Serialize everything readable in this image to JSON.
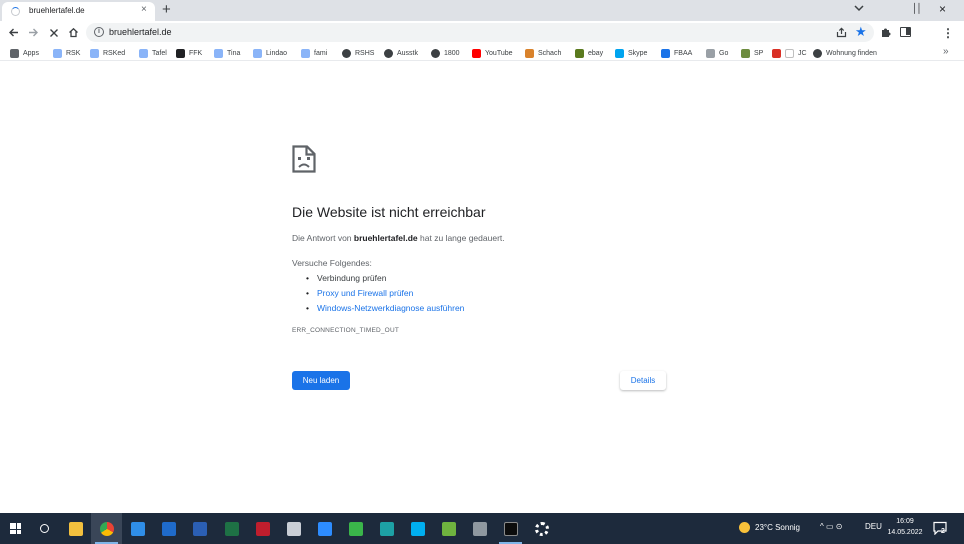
{
  "tab": {
    "title": "bruehlertafel.de",
    "close": "×"
  },
  "tabstrip": {
    "new_tab": "+",
    "minimize": "││",
    "close": "×"
  },
  "toolbar": {
    "url": "bruehlertafel.de",
    "star": "★",
    "menu": "⋮"
  },
  "bookmarks": {
    "items": [
      {
        "label": "Apps",
        "icon": "apps-icon",
        "color": "#5f6368"
      },
      {
        "label": "RSK",
        "icon": "doc-icon",
        "color": "#8ab4f8"
      },
      {
        "label": "RSKed",
        "icon": "doc-icon",
        "color": "#8ab4f8"
      },
      {
        "label": "Tafel",
        "icon": "doc-icon",
        "color": "#8ab4f8"
      },
      {
        "label": "FFK",
        "icon": "site-icon",
        "color": "#202124"
      },
      {
        "label": "Tina",
        "icon": "doc-icon",
        "color": "#8ab4f8"
      },
      {
        "label": "Lindao",
        "icon": "doc-icon",
        "color": "#8ab4f8"
      },
      {
        "label": "fami",
        "icon": "doc-icon",
        "color": "#8ab4f8"
      },
      {
        "label": "RSHS",
        "icon": "globe-icon",
        "color": "#3c4043"
      },
      {
        "label": "Ausstk",
        "icon": "globe-icon",
        "color": "#3c4043"
      },
      {
        "label": "1800",
        "icon": "globe-icon",
        "color": "#3c4043"
      },
      {
        "label": "YouTube",
        "icon": "youtube-icon",
        "color": "#ff0000"
      },
      {
        "label": "Schach",
        "icon": "chess-icon",
        "color": "#d9822b"
      },
      {
        "label": "ebay",
        "icon": "bag-icon",
        "color": "#5a7a1e"
      },
      {
        "label": "Skype",
        "icon": "windows-icon",
        "color": "#00a4ef"
      },
      {
        "label": "FBAA",
        "icon": "fbaa-icon",
        "color": "#1a73e8"
      },
      {
        "label": "Go",
        "icon": "link-icon",
        "color": "#9aa0a6"
      },
      {
        "label": "SP",
        "icon": "stack-icon",
        "color": "#6d8c3e"
      },
      {
        "label": "",
        "icon": "exclamation-icon",
        "color": "#d93025"
      },
      {
        "label": "JC",
        "icon": "doc-icon",
        "color": "#ffffff"
      },
      {
        "label": "Wohnung finden",
        "icon": "globe-icon",
        "color": "#3c4043"
      }
    ],
    "more": "»"
  },
  "error": {
    "heading": "Die Website ist nicht erreichbar",
    "desc_prefix": "Die Antwort von ",
    "desc_host": "bruehlertafel.de",
    "desc_suffix": " hat zu lange gedauert.",
    "try_label": "Versuche Folgendes:",
    "suggestions": [
      {
        "text": "Verbindung prüfen",
        "link": false
      },
      {
        "text": "Proxy und Firewall prüfen",
        "link": true
      },
      {
        "text": "Windows-Netzwerkdiagnose ausführen",
        "link": true
      }
    ],
    "code": "ERR_CONNECTION_TIMED_OUT",
    "reload_label": "Neu laden",
    "details_label": "Details",
    "link_color": "#1a73e8"
  },
  "taskbar": {
    "apps": [
      {
        "icon": "windows-start-icon",
        "color": "#ffffff"
      },
      {
        "icon": "search-icon",
        "color": "#ffffff"
      },
      {
        "icon": "file-explorer-icon",
        "color": "#f3c03e"
      },
      {
        "icon": "chrome-icon",
        "color": "#4285f4"
      },
      {
        "icon": "edge-legacy-icon",
        "color": "#2f8ee8"
      },
      {
        "icon": "outlook-icon",
        "color": "#1f6bcb"
      },
      {
        "icon": "word-icon",
        "color": "#2b5fb4"
      },
      {
        "icon": "excel-icon",
        "color": "#1e7145"
      },
      {
        "icon": "filezilla-icon",
        "color": "#bf1e2d"
      },
      {
        "icon": "printer-icon",
        "color": "#c9ced6"
      },
      {
        "icon": "zoom-icon",
        "color": "#2d8cff"
      },
      {
        "icon": "image-editor-icon",
        "color": "#3ab54a"
      },
      {
        "icon": "edge-icon",
        "color": "#1da1a5"
      },
      {
        "icon": "skype-icon",
        "color": "#00aff0"
      },
      {
        "icon": "photos-icon",
        "color": "#6fb33f"
      },
      {
        "icon": "steam-icon",
        "color": "#8f98a0"
      },
      {
        "icon": "terminal-icon",
        "color": "#0c0c0c"
      },
      {
        "icon": "settings-icon",
        "color": "#ffffff"
      }
    ],
    "weather": "23°C  Sonnig",
    "tray_symbols": "^  ▭  ⊙",
    "lang": "DEU",
    "time": "16:09",
    "date": "14.05.2022",
    "notifications": "2"
  }
}
